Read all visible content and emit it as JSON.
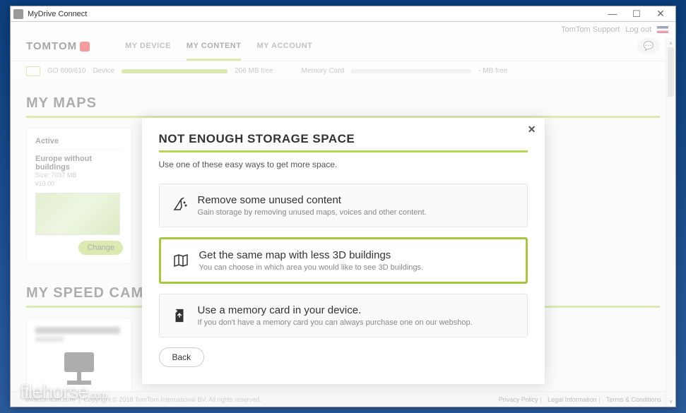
{
  "window": {
    "title": "MyDrive Connect"
  },
  "topbar": {
    "support": "TomTom Support",
    "logout": "Log out"
  },
  "logo": "TOMTOM",
  "nav": {
    "items": [
      {
        "label": "MY DEVICE",
        "active": false
      },
      {
        "label": "MY CONTENT",
        "active": true
      },
      {
        "label": "MY ACCOUNT",
        "active": false
      }
    ]
  },
  "storage": {
    "device_model": "GO 600/610",
    "device_label": "Device",
    "device_free": "206 MB  free",
    "memcard_label": "Memory Card",
    "memcard_free": "- MB  free"
  },
  "maps": {
    "heading": "MY MAPS",
    "card": {
      "status": "Active",
      "title": "Europe without buildings",
      "size": "Size:  7037 MB",
      "version": "v10.00",
      "change": "Change"
    }
  },
  "cams": {
    "heading": "MY SPEED CAMERAS"
  },
  "modal": {
    "title": "NOT ENOUGH STORAGE SPACE",
    "sub": "Use one of these easy ways to get more space.",
    "options": [
      {
        "title": "Remove some unused content",
        "desc": "Gain storage by removing unused maps, voices and other content.",
        "icon": "broom",
        "selected": false
      },
      {
        "title": "Get the same map with less 3D buildings",
        "desc": "You can choose in which area you would like to see 3D buildings.",
        "icon": "map",
        "selected": true
      },
      {
        "title": "Use a memory card in your device.",
        "desc": "If you don't have a memory card you can always purchase one on our webshop.",
        "icon": "card",
        "selected": false
      }
    ],
    "back": "Back"
  },
  "footer": {
    "site": "www.tomtom.com",
    "copy": "Copyright © 2018 TomTom International BV. All rights reserved.",
    "links": [
      "Privacy Policy",
      "Legal Information",
      "Terms & Conditions"
    ]
  },
  "watermark": "filehorse",
  "watermark_tld": ".com"
}
